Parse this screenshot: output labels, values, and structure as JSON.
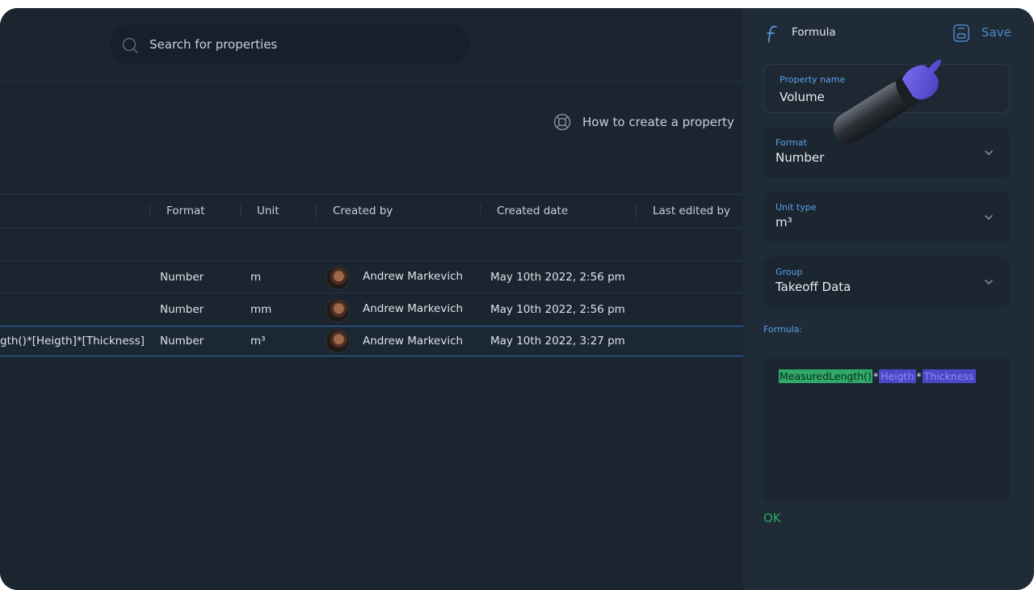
{
  "search": {
    "placeholder": "Search for properties"
  },
  "help": {
    "label": "How to create a property"
  },
  "table": {
    "columns": {
      "format": "Format",
      "unit": "Unit",
      "created_by": "Created by",
      "created_date": "Created date",
      "last_edited_by": "Last edited by"
    },
    "rows": [
      {
        "formula": "",
        "format": "Number",
        "unit": "m",
        "created_by": "Andrew Markevich",
        "created_date": "May 10th 2022, 2:56 pm"
      },
      {
        "formula": "",
        "format": "Number",
        "unit": "mm",
        "created_by": "Andrew Markevich",
        "created_date": "May 10th 2022, 2:56 pm"
      },
      {
        "formula": "gth()*[Heigth]*[Thickness]",
        "format": "Number",
        "unit": "m³",
        "created_by": "Andrew Markevich",
        "created_date": "May 10th 2022, 3:27 pm"
      }
    ]
  },
  "panel": {
    "title": "Formula",
    "save_label": "Save",
    "property_name": {
      "label": "Property name",
      "value": "Volume"
    },
    "format": {
      "label": "Format",
      "value": "Number"
    },
    "unit_type": {
      "label": "Unit type",
      "value": "m³"
    },
    "group": {
      "label": "Group",
      "value": "Takeoff Data"
    },
    "formula_label": "Formula:",
    "formula_tokens": {
      "fn": "MeasuredLength()",
      "op1": "*",
      "prop1": "Heigth",
      "op2": "*",
      "prop2": "Thickness"
    },
    "status": "OK"
  },
  "colors": {
    "background": "#1a2530",
    "panel": "#1f2b37",
    "accent_blue": "#5da0e6",
    "ok_green": "#27a75f",
    "token_function": "#2fa86a",
    "token_property": "#4b47c7"
  }
}
